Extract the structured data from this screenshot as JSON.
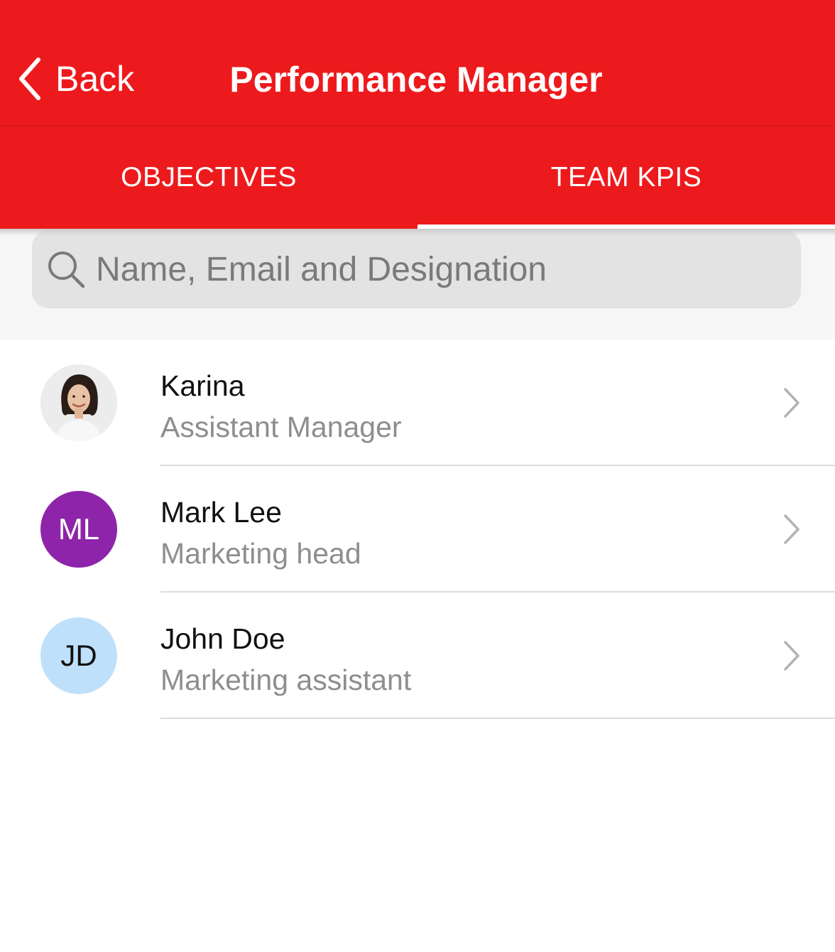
{
  "header": {
    "back_label": "Back",
    "title": "Performance Manager",
    "background_color": "#ed1a1d"
  },
  "tabs": [
    {
      "label": "OBJECTIVES",
      "active": false
    },
    {
      "label": "TEAM KPIS",
      "active": true
    }
  ],
  "search": {
    "placeholder": "Name, Email and Designation",
    "value": ""
  },
  "team_members": [
    {
      "name": "Karina",
      "role": "Assistant Manager",
      "avatar_type": "photo",
      "initials": "",
      "avatar_color": "#ececec",
      "initials_color": ""
    },
    {
      "name": "Mark Lee",
      "role": "Marketing head",
      "avatar_type": "initials",
      "initials": "ML",
      "avatar_color": "#8e24aa",
      "initials_color": "#ffffff"
    },
    {
      "name": "John Doe",
      "role": "Marketing assistant",
      "avatar_type": "initials",
      "initials": "JD",
      "avatar_color": "#bfe0fa",
      "initials_color": "#111111"
    }
  ]
}
